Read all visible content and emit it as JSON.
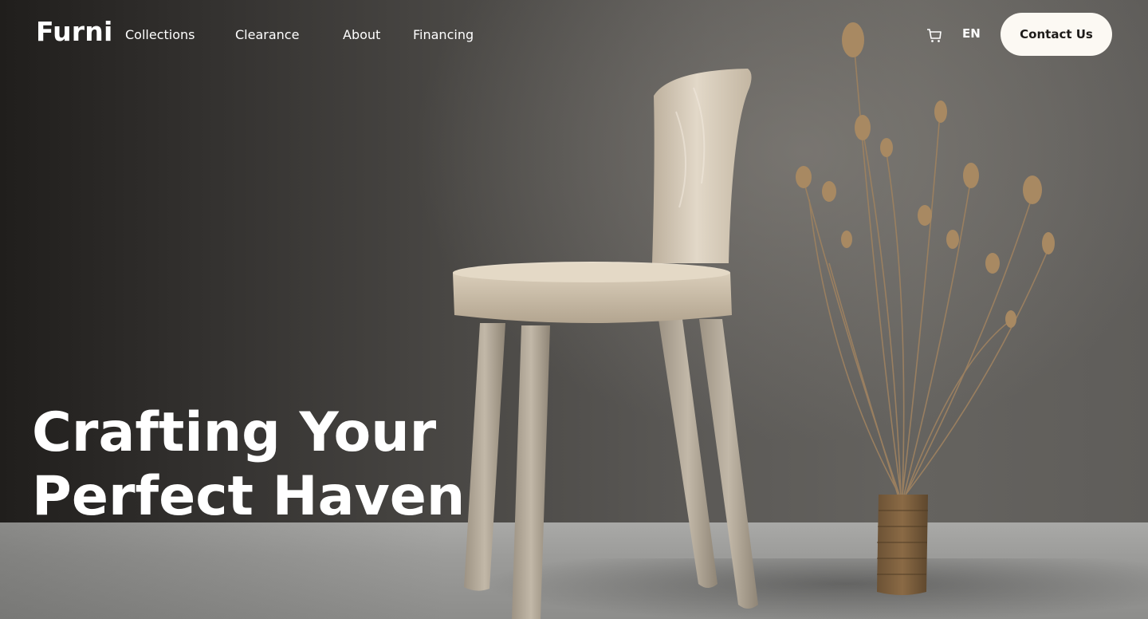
{
  "brand": {
    "logo": "Furni"
  },
  "nav": {
    "links": [
      "Collections",
      "Clearance",
      "About",
      "Financing"
    ],
    "language": "EN",
    "contact_label": "Contact Us",
    "cart_icon": "cart-icon"
  },
  "hero": {
    "headline_line1": "Crafting Your",
    "headline_line2": "Perfect Haven"
  },
  "colors": {
    "button_bg": "#fcf9f3",
    "button_text": "#1d1b19",
    "nav_text": "#ffffff"
  }
}
